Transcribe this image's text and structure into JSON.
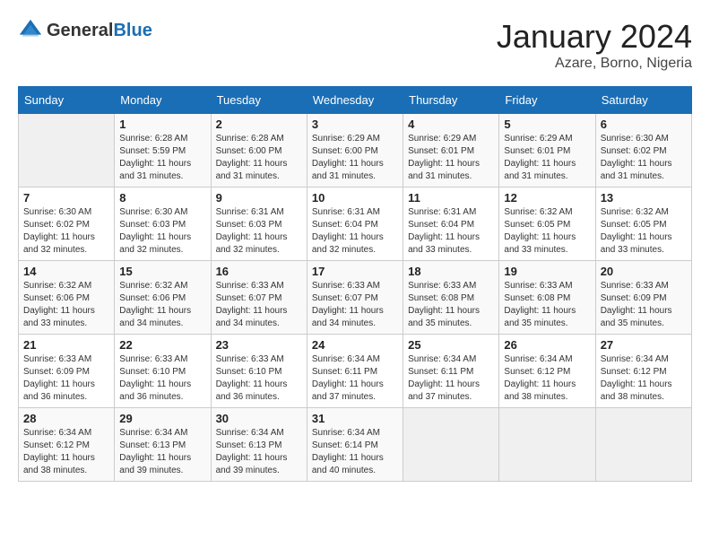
{
  "logo": {
    "text_general": "General",
    "text_blue": "Blue"
  },
  "title": "January 2024",
  "location": "Azare, Borno, Nigeria",
  "days_of_week": [
    "Sunday",
    "Monday",
    "Tuesday",
    "Wednesday",
    "Thursday",
    "Friday",
    "Saturday"
  ],
  "weeks": [
    [
      {
        "day": "",
        "sunrise": "",
        "sunset": "",
        "daylight": ""
      },
      {
        "day": "1",
        "sunrise": "Sunrise: 6:28 AM",
        "sunset": "Sunset: 5:59 PM",
        "daylight": "Daylight: 11 hours and 31 minutes."
      },
      {
        "day": "2",
        "sunrise": "Sunrise: 6:28 AM",
        "sunset": "Sunset: 6:00 PM",
        "daylight": "Daylight: 11 hours and 31 minutes."
      },
      {
        "day": "3",
        "sunrise": "Sunrise: 6:29 AM",
        "sunset": "Sunset: 6:00 PM",
        "daylight": "Daylight: 11 hours and 31 minutes."
      },
      {
        "day": "4",
        "sunrise": "Sunrise: 6:29 AM",
        "sunset": "Sunset: 6:01 PM",
        "daylight": "Daylight: 11 hours and 31 minutes."
      },
      {
        "day": "5",
        "sunrise": "Sunrise: 6:29 AM",
        "sunset": "Sunset: 6:01 PM",
        "daylight": "Daylight: 11 hours and 31 minutes."
      },
      {
        "day": "6",
        "sunrise": "Sunrise: 6:30 AM",
        "sunset": "Sunset: 6:02 PM",
        "daylight": "Daylight: 11 hours and 31 minutes."
      }
    ],
    [
      {
        "day": "7",
        "sunrise": "Sunrise: 6:30 AM",
        "sunset": "Sunset: 6:02 PM",
        "daylight": "Daylight: 11 hours and 32 minutes."
      },
      {
        "day": "8",
        "sunrise": "Sunrise: 6:30 AM",
        "sunset": "Sunset: 6:03 PM",
        "daylight": "Daylight: 11 hours and 32 minutes."
      },
      {
        "day": "9",
        "sunrise": "Sunrise: 6:31 AM",
        "sunset": "Sunset: 6:03 PM",
        "daylight": "Daylight: 11 hours and 32 minutes."
      },
      {
        "day": "10",
        "sunrise": "Sunrise: 6:31 AM",
        "sunset": "Sunset: 6:04 PM",
        "daylight": "Daylight: 11 hours and 32 minutes."
      },
      {
        "day": "11",
        "sunrise": "Sunrise: 6:31 AM",
        "sunset": "Sunset: 6:04 PM",
        "daylight": "Daylight: 11 hours and 33 minutes."
      },
      {
        "day": "12",
        "sunrise": "Sunrise: 6:32 AM",
        "sunset": "Sunset: 6:05 PM",
        "daylight": "Daylight: 11 hours and 33 minutes."
      },
      {
        "day": "13",
        "sunrise": "Sunrise: 6:32 AM",
        "sunset": "Sunset: 6:05 PM",
        "daylight": "Daylight: 11 hours and 33 minutes."
      }
    ],
    [
      {
        "day": "14",
        "sunrise": "Sunrise: 6:32 AM",
        "sunset": "Sunset: 6:06 PM",
        "daylight": "Daylight: 11 hours and 33 minutes."
      },
      {
        "day": "15",
        "sunrise": "Sunrise: 6:32 AM",
        "sunset": "Sunset: 6:06 PM",
        "daylight": "Daylight: 11 hours and 34 minutes."
      },
      {
        "day": "16",
        "sunrise": "Sunrise: 6:33 AM",
        "sunset": "Sunset: 6:07 PM",
        "daylight": "Daylight: 11 hours and 34 minutes."
      },
      {
        "day": "17",
        "sunrise": "Sunrise: 6:33 AM",
        "sunset": "Sunset: 6:07 PM",
        "daylight": "Daylight: 11 hours and 34 minutes."
      },
      {
        "day": "18",
        "sunrise": "Sunrise: 6:33 AM",
        "sunset": "Sunset: 6:08 PM",
        "daylight": "Daylight: 11 hours and 35 minutes."
      },
      {
        "day": "19",
        "sunrise": "Sunrise: 6:33 AM",
        "sunset": "Sunset: 6:08 PM",
        "daylight": "Daylight: 11 hours and 35 minutes."
      },
      {
        "day": "20",
        "sunrise": "Sunrise: 6:33 AM",
        "sunset": "Sunset: 6:09 PM",
        "daylight": "Daylight: 11 hours and 35 minutes."
      }
    ],
    [
      {
        "day": "21",
        "sunrise": "Sunrise: 6:33 AM",
        "sunset": "Sunset: 6:09 PM",
        "daylight": "Daylight: 11 hours and 36 minutes."
      },
      {
        "day": "22",
        "sunrise": "Sunrise: 6:33 AM",
        "sunset": "Sunset: 6:10 PM",
        "daylight": "Daylight: 11 hours and 36 minutes."
      },
      {
        "day": "23",
        "sunrise": "Sunrise: 6:33 AM",
        "sunset": "Sunset: 6:10 PM",
        "daylight": "Daylight: 11 hours and 36 minutes."
      },
      {
        "day": "24",
        "sunrise": "Sunrise: 6:34 AM",
        "sunset": "Sunset: 6:11 PM",
        "daylight": "Daylight: 11 hours and 37 minutes."
      },
      {
        "day": "25",
        "sunrise": "Sunrise: 6:34 AM",
        "sunset": "Sunset: 6:11 PM",
        "daylight": "Daylight: 11 hours and 37 minutes."
      },
      {
        "day": "26",
        "sunrise": "Sunrise: 6:34 AM",
        "sunset": "Sunset: 6:12 PM",
        "daylight": "Daylight: 11 hours and 38 minutes."
      },
      {
        "day": "27",
        "sunrise": "Sunrise: 6:34 AM",
        "sunset": "Sunset: 6:12 PM",
        "daylight": "Daylight: 11 hours and 38 minutes."
      }
    ],
    [
      {
        "day": "28",
        "sunrise": "Sunrise: 6:34 AM",
        "sunset": "Sunset: 6:12 PM",
        "daylight": "Daylight: 11 hours and 38 minutes."
      },
      {
        "day": "29",
        "sunrise": "Sunrise: 6:34 AM",
        "sunset": "Sunset: 6:13 PM",
        "daylight": "Daylight: 11 hours and 39 minutes."
      },
      {
        "day": "30",
        "sunrise": "Sunrise: 6:34 AM",
        "sunset": "Sunset: 6:13 PM",
        "daylight": "Daylight: 11 hours and 39 minutes."
      },
      {
        "day": "31",
        "sunrise": "Sunrise: 6:34 AM",
        "sunset": "Sunset: 6:14 PM",
        "daylight": "Daylight: 11 hours and 40 minutes."
      },
      {
        "day": "",
        "sunrise": "",
        "sunset": "",
        "daylight": ""
      },
      {
        "day": "",
        "sunrise": "",
        "sunset": "",
        "daylight": ""
      },
      {
        "day": "",
        "sunrise": "",
        "sunset": "",
        "daylight": ""
      }
    ]
  ]
}
